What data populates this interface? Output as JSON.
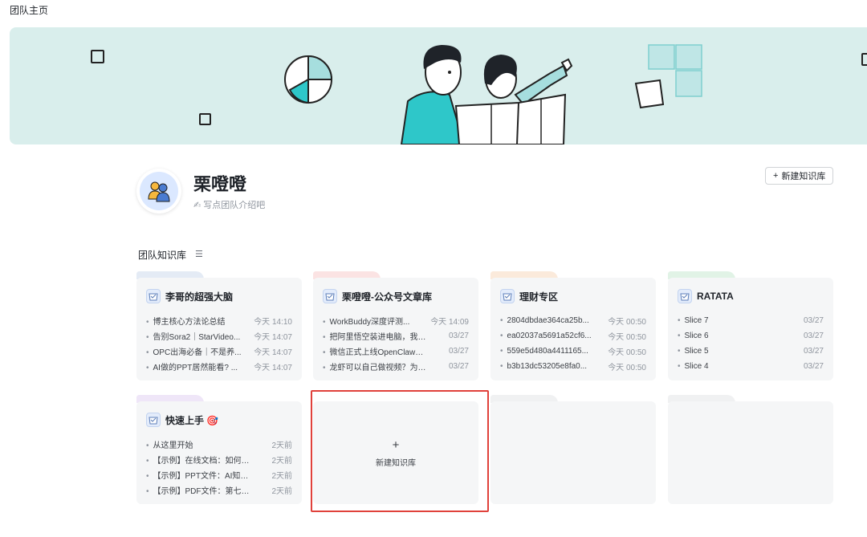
{
  "page": {
    "title": "团队主页"
  },
  "team": {
    "name": "栗噔噔",
    "description": "✍ 写点团队介绍吧",
    "new_kb_button": "新建知识库"
  },
  "section": {
    "title": "团队知识库"
  },
  "colors": {
    "banner_bg": "#d9eeec",
    "accent_teal": "#2ec7c9",
    "highlight_red": "#e0413b"
  },
  "knowledge_bases": [
    {
      "title": "李哥的超强大脑",
      "docs": [
        {
          "name": "博主核心方法论总结",
          "time": "今天 14:10"
        },
        {
          "name": "告别Sora2｜StarVideo...",
          "time": "今天 14:07"
        },
        {
          "name": "OPC出海必备｜不是养...",
          "time": "今天 14:07"
        },
        {
          "name": "AI做的PPT居然能看? ...",
          "time": "今天 14:07"
        }
      ]
    },
    {
      "title": "栗噔噔-公众号文章库",
      "docs": [
        {
          "name": "WorkBuddy深度评测...",
          "time": "今天 14:09"
        },
        {
          "name": "把阿里悟空装进电脑，我的...",
          "time": "03/27"
        },
        {
          "name": "微信正式上线OpenClaw插...",
          "time": "03/27"
        },
        {
          "name": "龙虾可以自己做视频？为什...",
          "time": "03/27"
        }
      ]
    },
    {
      "title": "理财专区",
      "docs": [
        {
          "name": "2804dbdae364ca25b...",
          "time": "今天 00:50"
        },
        {
          "name": "ea02037a5691a52cf6...",
          "time": "今天 00:50"
        },
        {
          "name": "559e5d480a4411165...",
          "time": "今天 00:50"
        },
        {
          "name": "b3b13dc53205e8fa0...",
          "time": "今天 00:50"
        }
      ]
    },
    {
      "title": "RATATA",
      "docs": [
        {
          "name": "Slice 7",
          "time": "03/27"
        },
        {
          "name": "Slice 6",
          "time": "03/27"
        },
        {
          "name": "Slice 5",
          "time": "03/27"
        },
        {
          "name": "Slice 4",
          "time": "03/27"
        }
      ]
    },
    {
      "title": "快速上手 🎯",
      "docs": [
        {
          "name": "从这里开始",
          "time": "2天前"
        },
        {
          "name": "【示例】在线文档：如何创...",
          "time": "2天前"
        },
        {
          "name": "【示例】PPT文件：AI知识...",
          "time": "2天前"
        },
        {
          "name": "【示例】PDF文件：第七次...",
          "time": "2天前"
        }
      ]
    }
  ],
  "new_kb_card": {
    "plus": "+",
    "label": "新建知识库"
  }
}
